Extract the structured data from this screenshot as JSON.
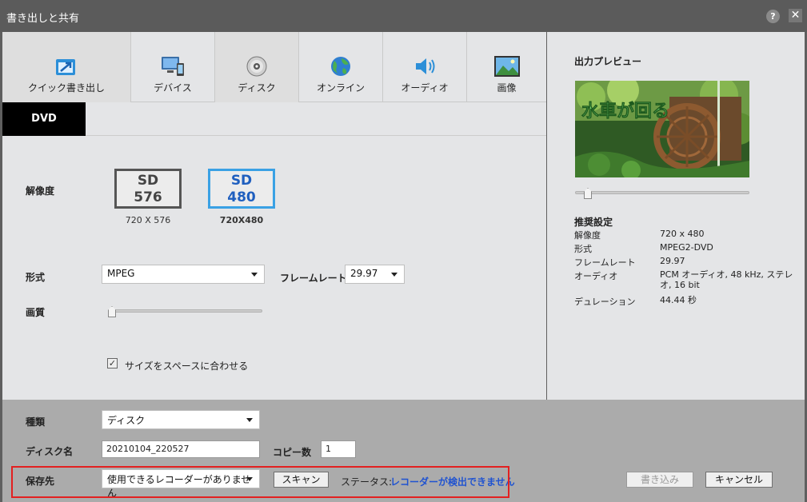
{
  "window": {
    "title": "書き出しと共有",
    "help_label": "?",
    "close_label": "✕"
  },
  "tabs": [
    {
      "label": "クイック書き出し",
      "icon": "quick-export-icon",
      "active": true
    },
    {
      "label": "デバイス",
      "icon": "device-icon"
    },
    {
      "label": "ディスク",
      "icon": "disc-icon",
      "active": true
    },
    {
      "label": "オンライン",
      "icon": "globe-icon"
    },
    {
      "label": "オーディオ",
      "icon": "speaker-icon"
    },
    {
      "label": "画像",
      "icon": "picture-icon"
    }
  ],
  "subtab": {
    "label": "DVD"
  },
  "resolution": {
    "label": "解像度",
    "options": [
      {
        "line1": "SD",
        "line2": "576",
        "caption": "720 X 576",
        "selected": false
      },
      {
        "line1": "SD",
        "line2": "480",
        "caption": "720X480",
        "selected": true
      }
    ]
  },
  "format": {
    "label": "形式",
    "value": "MPEG"
  },
  "framerate": {
    "label": "フレームレート",
    "value": "29.97"
  },
  "quality": {
    "label": "画質",
    "level": 0.0
  },
  "fit_option": {
    "label": "サイズをスペースに合わせる",
    "checked": true
  },
  "preview": {
    "title": "出力プレビュー",
    "overlay_text": "水車が回る",
    "scrub_position": 0.08
  },
  "recommended": {
    "title": "推奨設定",
    "rows": [
      {
        "key": "解像度",
        "value": "720 x 480"
      },
      {
        "key": "形式",
        "value": "MPEG2-DVD"
      },
      {
        "key": "フレームレート",
        "value": "29.97"
      },
      {
        "key": "オーディオ",
        "value": "PCM オーディオ, 48 kHz, ステレオ, 16 bit"
      },
      {
        "key": "デュレーション",
        "value": "44.44 秒"
      }
    ]
  },
  "bottom": {
    "type_label": "種類",
    "type_value": "ディスク",
    "disc_name_label": "ディスク名",
    "disc_name_value": "20210104_220527",
    "copies_label": "コピー数",
    "copies_value": "1",
    "destination_label": "保存先",
    "destination_value": "使用できるレコーダーがありません",
    "scan_label": "スキャン",
    "status_label": "ステータス:",
    "status_value": "レコーダーが検出できません",
    "write_label": "書き込み",
    "cancel_label": "キャンセル"
  },
  "colors": {
    "titlebar": "#5b5b5b",
    "panel": "#e4e5e7",
    "bottom_panel": "#ababab",
    "selected_border": "#3aa1e4",
    "status_blue": "#2053d0",
    "highlight_red": "#e32020"
  }
}
